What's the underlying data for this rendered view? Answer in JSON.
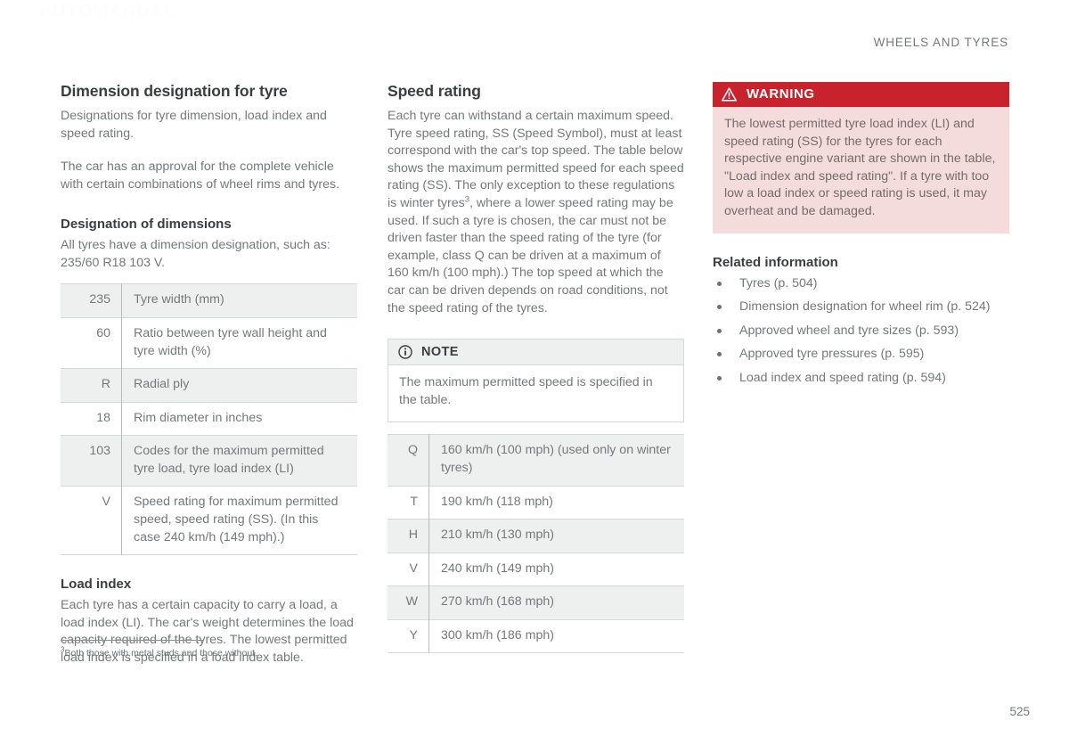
{
  "watermark": "AUTOMANUAL",
  "header": {
    "running_title": "WHEELS AND TYRES",
    "page_number": "525"
  },
  "left_column": {
    "section_title": "Dimension designation for tyre",
    "intro": "Designations for tyre dimension, load index and speed rating.",
    "paragraph": "The car has an approval for the complete vehicle with certain combinations of wheel rims and tyres.",
    "dimensions_heading": "Designation of dimensions",
    "dimensions_intro": "All tyres have a dimension designation, such as: 235/60 R18 103 V.",
    "dimensions_table": [
      {
        "key": "235",
        "value": "Tyre width (mm)",
        "shaded": true
      },
      {
        "key": "60",
        "value": "Ratio between tyre wall height and tyre width (%)",
        "shaded": false
      },
      {
        "key": "R",
        "value": "Radial ply",
        "shaded": true
      },
      {
        "key": "18",
        "value": "Rim diameter in inches",
        "shaded": false
      },
      {
        "key": "103",
        "value": "Codes for the maximum permitted tyre load, tyre load index (LI)",
        "shaded": true
      },
      {
        "key": "V",
        "value": "Speed rating for maximum permitted speed, speed rating (SS). (In this case 240 km/h (149 mph).)",
        "shaded": false
      }
    ],
    "load_index_heading": "Load index",
    "load_index_text": "Each tyre has a certain capacity to carry a load, a load index (LI). The car's weight determines the load capacity required of the tyres. The lowest permitted load index is specified in a load index table."
  },
  "footnote": {
    "marker": "3",
    "text": "Both those with metal studs and those without."
  },
  "mid_column": {
    "section_title": "Speed rating",
    "paragraph_part1": "Each tyre can withstand a certain maximum speed. Tyre speed rating, SS (Speed Symbol), must at least correspond with the car's top speed. The table below shows the maximum permitted speed for each speed rating (SS). The only exception to these regulations is winter tyres",
    "footnote_marker": "3",
    "paragraph_part2": ", where a lower speed rating may be used. If such a tyre is chosen, the car must not be driven faster than the speed rating of the tyre (for example, class Q can be driven at a maximum of 160 km/h (100 mph).) The top speed at which the car can be driven depends on road conditions, not the speed rating of the tyres.",
    "note": {
      "icon": "info-icon",
      "label": "NOTE",
      "text": "The maximum permitted speed is specified in the table."
    },
    "speed_table": [
      {
        "key": "Q",
        "value": "160 km/h (100 mph) (used only on winter tyres)",
        "shaded": true
      },
      {
        "key": "T",
        "value": "190 km/h (118 mph)",
        "shaded": false
      },
      {
        "key": "H",
        "value": "210 km/h (130 mph)",
        "shaded": true
      },
      {
        "key": "V",
        "value": "240 km/h (149 mph)",
        "shaded": false
      },
      {
        "key": "W",
        "value": "270 km/h (168 mph)",
        "shaded": true
      },
      {
        "key": "Y",
        "value": "300 km/h (186 mph)",
        "shaded": false
      }
    ]
  },
  "right_column": {
    "warning": {
      "icon": "warning-triangle-icon",
      "label": "WARNING",
      "text": "The lowest permitted tyre load index (LI) and speed rating (SS) for the tyres for each respective engine variant are shown in the table, \"Load index and speed rating\". If a tyre with too low a load index or speed rating is used, it may overheat and be damaged."
    },
    "related_title": "Related information",
    "related_items": [
      "Tyres (p. 504)",
      "Dimension designation for wheel rim (p. 524)",
      "Approved wheel and tyre sizes (p. 593)",
      "Approved tyre pressures (p. 595)",
      "Load index and speed rating (p. 594)"
    ]
  },
  "colors": {
    "warning_red": "#c8232c",
    "warning_body": "#f4dcdd",
    "table_shade": "#eeefef",
    "body_text": "#76787a",
    "heading_text": "#3b3d3f"
  }
}
